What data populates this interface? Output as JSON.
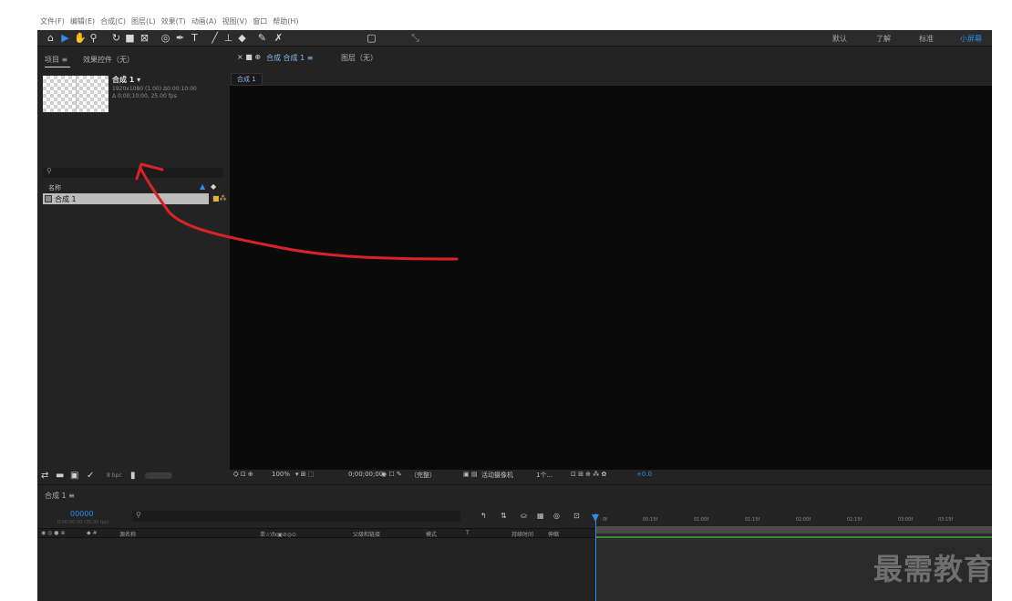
{
  "menubar": {
    "items": [
      "文件(F)",
      "编辑(E)",
      "合成(C)",
      "图层(L)",
      "效果(T)",
      "动画(A)",
      "视图(V)",
      "窗口",
      "帮助(H)"
    ]
  },
  "toolbar": {
    "workspaces": [
      "默认",
      "了解",
      "标准",
      "小屏幕"
    ],
    "active_workspace": "小屏幕",
    "accent_color": "#2d8ceb"
  },
  "project": {
    "tab_project": "项目 ≡",
    "tab_effects": "效果控件（无）",
    "comp_name": "合成 1 ▾",
    "comp_info_1": "1920x1080 (1.00) Δ0:00:10:00",
    "comp_info_2": "Δ 0;00;10;00, 25.00 fps",
    "search_icon": "search-icon",
    "column_name": "名称",
    "item_name": "合成 1",
    "bpc": "8 bpc"
  },
  "composition": {
    "tab_label": "合成 合成 1 ≡",
    "layer_tab": "图层（无）",
    "subtab": "合成 1",
    "zoom": "100%",
    "timecode": "0;00;00;00",
    "quality": "（完整）",
    "camera": "活动摄像机",
    "views": "1个...",
    "exposure": "+0.0"
  },
  "timeline": {
    "tab_label": "合成 1 ≡",
    "current_time": "00000",
    "frames": "0;00;00;00 (25.00 fps)",
    "columns": {
      "source_name": "源名称",
      "switches": "单☆\\fx▣⊘◎⊙",
      "parent": "父级和链接",
      "mode": "模式",
      "trkmat": "T",
      "duration": "持续时间",
      "stretch": "伸缩"
    },
    "ruler_ticks": [
      "0f",
      "00:15f",
      "01:00f",
      "01:15f",
      "02:00f",
      "02:15f",
      "03:00f",
      "03:15f"
    ]
  },
  "watermark": "最需教育"
}
